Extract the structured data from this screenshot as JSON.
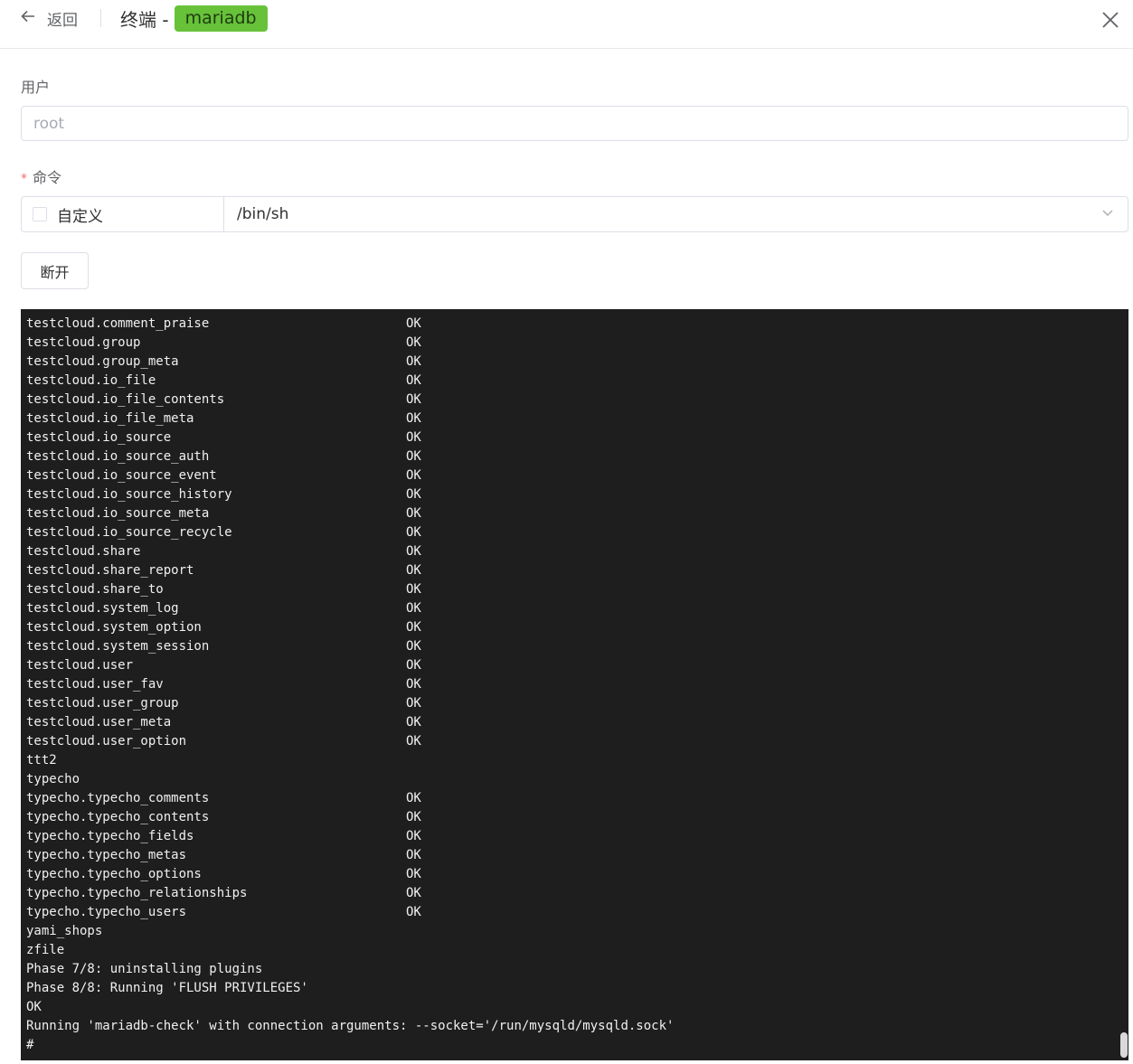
{
  "header": {
    "back_label": "返回",
    "title": "终端 -",
    "tag": "mariadb"
  },
  "form": {
    "user_label": "用户",
    "user_placeholder": "root",
    "command_label": "命令",
    "custom_label": "自定义",
    "command_value": "/bin/sh",
    "disconnect_label": "断开"
  },
  "terminal": {
    "lines": [
      {
        "text": "testcloud.comment_praise",
        "status": "OK"
      },
      {
        "text": "testcloud.group",
        "status": "OK"
      },
      {
        "text": "testcloud.group_meta",
        "status": "OK"
      },
      {
        "text": "testcloud.io_file",
        "status": "OK"
      },
      {
        "text": "testcloud.io_file_contents",
        "status": "OK"
      },
      {
        "text": "testcloud.io_file_meta",
        "status": "OK"
      },
      {
        "text": "testcloud.io_source",
        "status": "OK"
      },
      {
        "text": "testcloud.io_source_auth",
        "status": "OK"
      },
      {
        "text": "testcloud.io_source_event",
        "status": "OK"
      },
      {
        "text": "testcloud.io_source_history",
        "status": "OK"
      },
      {
        "text": "testcloud.io_source_meta",
        "status": "OK"
      },
      {
        "text": "testcloud.io_source_recycle",
        "status": "OK"
      },
      {
        "text": "testcloud.share",
        "status": "OK"
      },
      {
        "text": "testcloud.share_report",
        "status": "OK"
      },
      {
        "text": "testcloud.share_to",
        "status": "OK"
      },
      {
        "text": "testcloud.system_log",
        "status": "OK"
      },
      {
        "text": "testcloud.system_option",
        "status": "OK"
      },
      {
        "text": "testcloud.system_session",
        "status": "OK"
      },
      {
        "text": "testcloud.user",
        "status": "OK"
      },
      {
        "text": "testcloud.user_fav",
        "status": "OK"
      },
      {
        "text": "testcloud.user_group",
        "status": "OK"
      },
      {
        "text": "testcloud.user_meta",
        "status": "OK"
      },
      {
        "text": "testcloud.user_option",
        "status": "OK"
      },
      {
        "text": "ttt2",
        "status": ""
      },
      {
        "text": "typecho",
        "status": ""
      },
      {
        "text": "typecho.typecho_comments",
        "status": "OK"
      },
      {
        "text": "typecho.typecho_contents",
        "status": "OK"
      },
      {
        "text": "typecho.typecho_fields",
        "status": "OK"
      },
      {
        "text": "typecho.typecho_metas",
        "status": "OK"
      },
      {
        "text": "typecho.typecho_options",
        "status": "OK"
      },
      {
        "text": "typecho.typecho_relationships",
        "status": "OK"
      },
      {
        "text": "typecho.typecho_users",
        "status": "OK"
      },
      {
        "text": "yami_shops",
        "status": ""
      },
      {
        "text": "zfile",
        "status": ""
      },
      {
        "text": "Phase 7/8: uninstalling plugins",
        "status": ""
      },
      {
        "text": "Phase 8/8: Running 'FLUSH PRIVILEGES'",
        "status": ""
      },
      {
        "text": "OK",
        "status": ""
      },
      {
        "text": "Running 'mariadb-check' with connection arguments: --socket='/run/mysqld/mysqld.sock'",
        "status": ""
      },
      {
        "text": "#",
        "status": ""
      }
    ]
  },
  "icons": {
    "back": "arrow-left-icon",
    "close": "close-icon",
    "select": "chevron-down-icon"
  },
  "colors": {
    "tag_bg": "#67c23a",
    "terminal_bg": "#1e1e1e",
    "required": "#f56c6c"
  }
}
